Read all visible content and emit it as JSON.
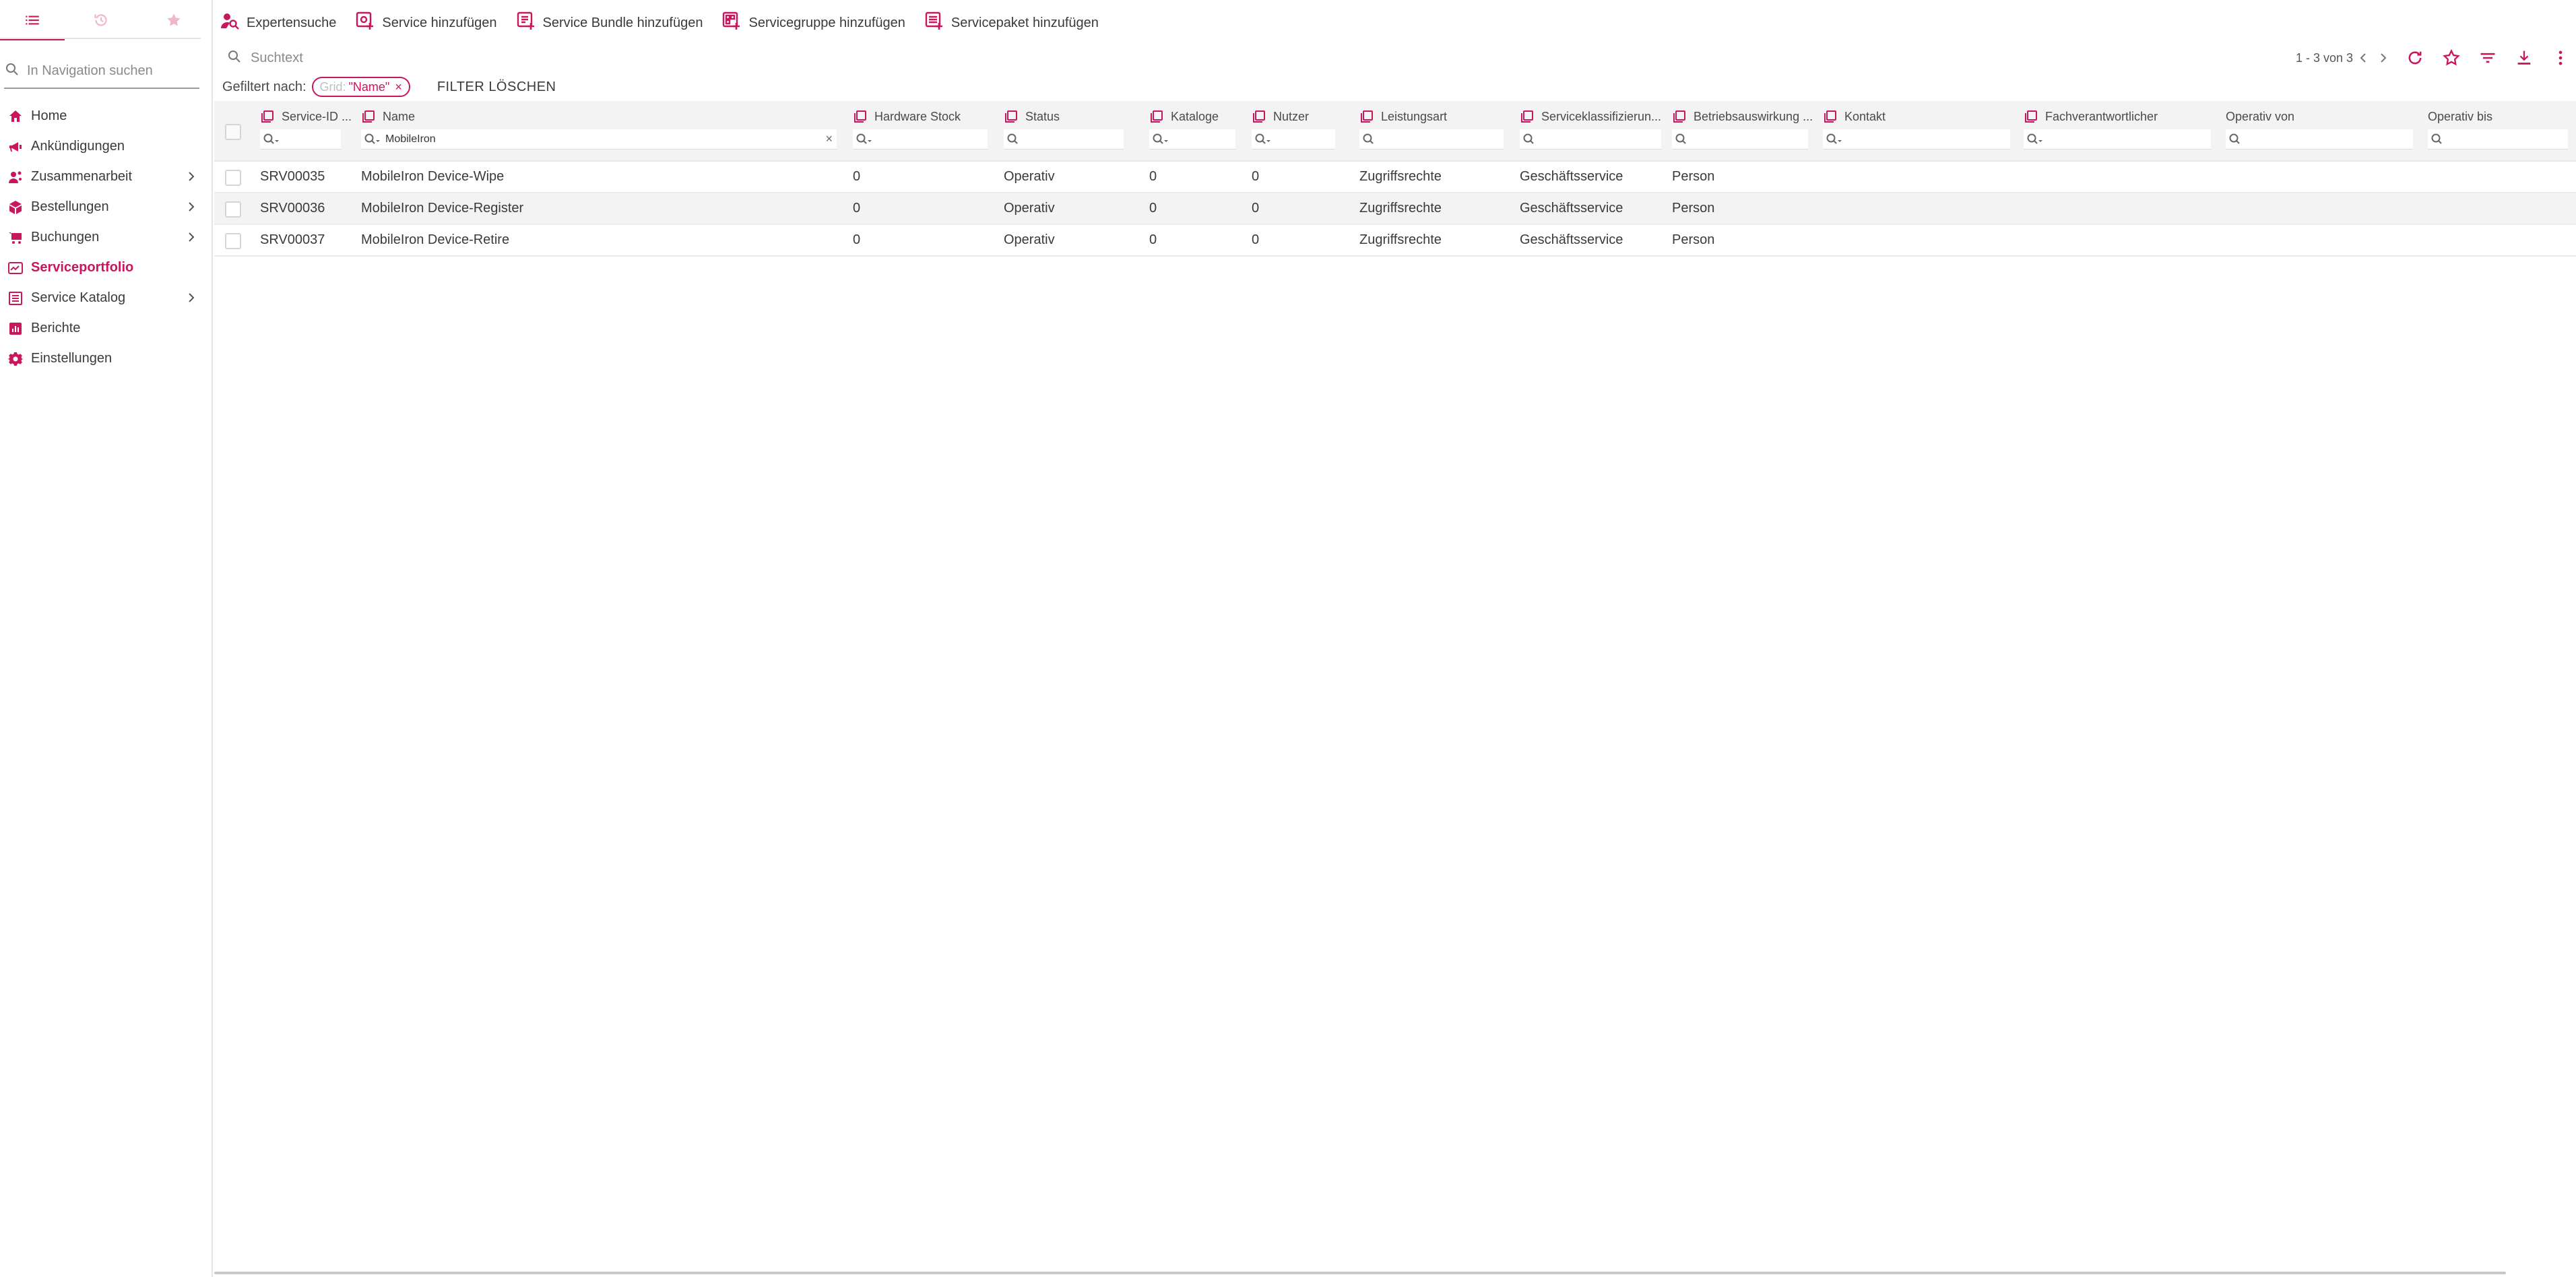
{
  "sidebar": {
    "search_placeholder": "In Navigation suchen",
    "tabs": [
      {
        "icon": "list-icon"
      },
      {
        "icon": "history-icon"
      },
      {
        "icon": "star-icon"
      }
    ],
    "items": [
      {
        "label": "Home",
        "icon": "home-icon"
      },
      {
        "label": "Ankündigungen",
        "icon": "megaphone-icon"
      },
      {
        "label": "Zusammenarbeit",
        "icon": "people-icon",
        "has_children": true
      },
      {
        "label": "Bestellungen",
        "icon": "box-icon",
        "has_children": true
      },
      {
        "label": "Buchungen",
        "icon": "cart-icon",
        "has_children": true
      },
      {
        "label": "Serviceportfolio",
        "icon": "portfolio-icon",
        "active": true
      },
      {
        "label": "Service Katalog",
        "icon": "catalog-icon",
        "has_children": true
      },
      {
        "label": "Berichte",
        "icon": "report-icon"
      },
      {
        "label": "Einstellungen",
        "icon": "gear-icon"
      }
    ]
  },
  "toolbar": {
    "expert_search": "Expertensuche",
    "add_service": "Service hinzufügen",
    "add_bundle": "Service Bundle hinzufügen",
    "add_group": "Servicegruppe hinzufügen",
    "add_package": "Servicepaket hinzufügen"
  },
  "search": {
    "placeholder": "Suchtext"
  },
  "pager": {
    "text": "1 - 3 von 3"
  },
  "filter": {
    "label": "Gefiltert nach:",
    "chip_prefix": "Grid:",
    "chip_value": "\"Name\"",
    "chip_close": "×",
    "clear_label": "FILTER LÖSCHEN"
  },
  "grid": {
    "columns": [
      {
        "label": "Service-ID ...",
        "filter": ""
      },
      {
        "label": "Name",
        "filter": "MobileIron"
      },
      {
        "label": "Hardware Stock",
        "filter": ""
      },
      {
        "label": "Status",
        "filter": ""
      },
      {
        "label": "Kataloge",
        "filter": ""
      },
      {
        "label": "Nutzer",
        "filter": ""
      },
      {
        "label": "Leistungsart",
        "filter": ""
      },
      {
        "label": "Serviceklassifizierun...",
        "filter": ""
      },
      {
        "label": "Betriebsauswirkung ...",
        "filter": ""
      },
      {
        "label": "Kontakt",
        "filter": ""
      },
      {
        "label": "Fachverantwortlicher",
        "filter": ""
      },
      {
        "label": "Operativ von",
        "filter": ""
      },
      {
        "label": "Operativ bis",
        "filter": ""
      }
    ],
    "rows": [
      {
        "id": "SRV00035",
        "name": "MobileIron Device-Wipe",
        "hw": "0",
        "status": "Operativ",
        "kataloge": "0",
        "nutzer": "0",
        "leistungsart": "Zugriffsrechte",
        "klass": "Geschäftsservice",
        "betrieb": "Person",
        "kontakt": "",
        "fach": "",
        "von": "",
        "bis": ""
      },
      {
        "id": "SRV00036",
        "name": "MobileIron Device-Register",
        "hw": "0",
        "status": "Operativ",
        "kataloge": "0",
        "nutzer": "0",
        "leistungsart": "Zugriffsrechte",
        "klass": "Geschäftsservice",
        "betrieb": "Person",
        "kontakt": "",
        "fach": "",
        "von": "",
        "bis": ""
      },
      {
        "id": "SRV00037",
        "name": "MobileIron Device-Retire",
        "hw": "0",
        "status": "Operativ",
        "kataloge": "0",
        "nutzer": "0",
        "leistungsart": "Zugriffsrechte",
        "klass": "Geschäftsservice",
        "betrieb": "Person",
        "kontakt": "",
        "fach": "",
        "von": "",
        "bis": ""
      }
    ]
  },
  "colors": {
    "accent": "#c8175d",
    "text": "#3a3a3a",
    "header_bg": "#f3f3f3"
  }
}
